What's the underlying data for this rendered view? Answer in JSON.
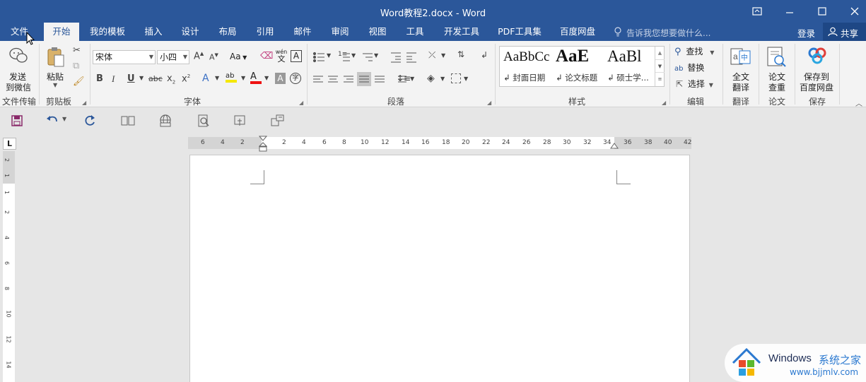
{
  "window": {
    "title": "Word教程2.docx - Word",
    "icons": [
      "ribbon-display-icon",
      "minimize-icon",
      "maximize-icon",
      "close-icon"
    ]
  },
  "tabs": {
    "items": [
      "文件",
      "开始",
      "我的模板",
      "插入",
      "设计",
      "布局",
      "引用",
      "邮件",
      "审阅",
      "视图",
      "工具",
      "开发工具",
      "PDF工具集",
      "百度网盘"
    ],
    "active": "开始",
    "tell_me": "告诉我您想要做什么...",
    "login": "登录",
    "share": "共享"
  },
  "ribbon": {
    "send": {
      "line1": "发送",
      "line2": "到微信",
      "group": "文件传输"
    },
    "clipboard": {
      "paste": "粘贴",
      "group": "剪贴板"
    },
    "font": {
      "name": "宋体",
      "size": "小四",
      "case_btn": "Aa",
      "group": "字体",
      "wen": "wén",
      "wen_char": "文"
    },
    "paragraph": {
      "group": "段落"
    },
    "styles": {
      "group": "样式",
      "items": [
        {
          "sample": "AaBbCc",
          "name": "↲ 封面日期"
        },
        {
          "sample": "AaE",
          "name": "↲ 论文标题"
        },
        {
          "sample": "AaBl",
          "name": "↲ 硕士学..."
        }
      ]
    },
    "editing": {
      "find": "查找",
      "replace": "替换",
      "select": "选择",
      "group": "编辑"
    },
    "translate": {
      "line1": "全文",
      "line2": "翻译",
      "group": "翻译"
    },
    "paper": {
      "line1": "论文",
      "line2": "查重",
      "group": "论文"
    },
    "save": {
      "line1": "保存到",
      "line2": "百度网盘",
      "group": "保存"
    }
  },
  "ruler": {
    "left_ticks": [
      "6",
      "4",
      "2"
    ],
    "right_ticks": [
      "2",
      "4",
      "6",
      "8",
      "10",
      "12",
      "14",
      "16",
      "18",
      "20",
      "22",
      "24",
      "26",
      "28",
      "30",
      "32",
      "34",
      "36",
      "38",
      "40",
      "42"
    ],
    "vertical_ticks": [
      "2",
      "1",
      "1",
      "2",
      "4",
      "6",
      "8",
      "10",
      "12",
      "14"
    ],
    "tab_selector": "L"
  },
  "watermark": {
    "brand": "Windows",
    "text": "系统之家",
    "url": "www.bjjmlv.com"
  }
}
